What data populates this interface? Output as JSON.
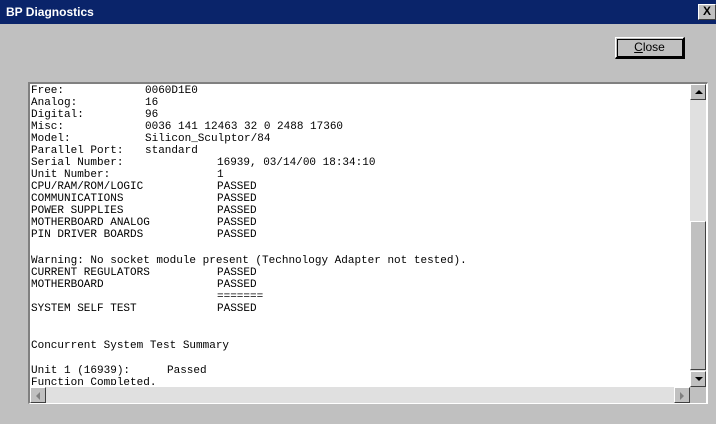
{
  "window": {
    "title": "BP Diagnostics",
    "close_glyph": "X"
  },
  "toolbar": {
    "close_label_first": "C",
    "close_label_rest": "lose"
  },
  "output": {
    "lines": [
      {
        "label": "Free:",
        "value": "0060D1E0"
      },
      {
        "label": "Analog:",
        "value": "16"
      },
      {
        "label": "Digital:",
        "value": "96"
      },
      {
        "label": "Misc:",
        "value": "0036 141 12463 32 0 2488 17360"
      },
      {
        "label": "Model:",
        "value": "Silicon_Sculptor/84"
      },
      {
        "label": "Parallel Port:",
        "value": "standard"
      },
      {
        "label": "Serial Number:",
        "value": "16939, 03/14/00 18:34:10"
      },
      {
        "label": "Unit Number:",
        "value": "1"
      },
      {
        "label": "CPU/RAM/ROM/LOGIC",
        "value": "PASSED"
      },
      {
        "label": "COMMUNICATIONS",
        "value": "PASSED"
      },
      {
        "label": "POWER SUPPLIES",
        "value": "PASSED"
      },
      {
        "label": "MOTHERBOARD ANALOG",
        "value": "PASSED"
      },
      {
        "label": "PIN DRIVER BOARDS",
        "value": "PASSED"
      },
      {
        "label": "Warning: No socket module present (Technology Adapter not tested).",
        "value": ""
      },
      {
        "label": "CURRENT REGULATORS",
        "value": "PASSED"
      },
      {
        "label": "MOTHERBOARD",
        "value": "PASSED"
      },
      {
        "label": "",
        "value": "======="
      },
      {
        "label": "SYSTEM SELF TEST",
        "value": "PASSED"
      },
      {
        "label": "Concurrent System Test Summary",
        "value": ""
      },
      {
        "label": "Unit 1 (16939):",
        "value": "Passed"
      },
      {
        "label": "Function Completed.",
        "value": ""
      }
    ]
  },
  "scrollbar": {
    "up_icon": "arrow-up",
    "down_icon": "arrow-down",
    "left_icon": "arrow-left",
    "right_icon": "arrow-right"
  }
}
